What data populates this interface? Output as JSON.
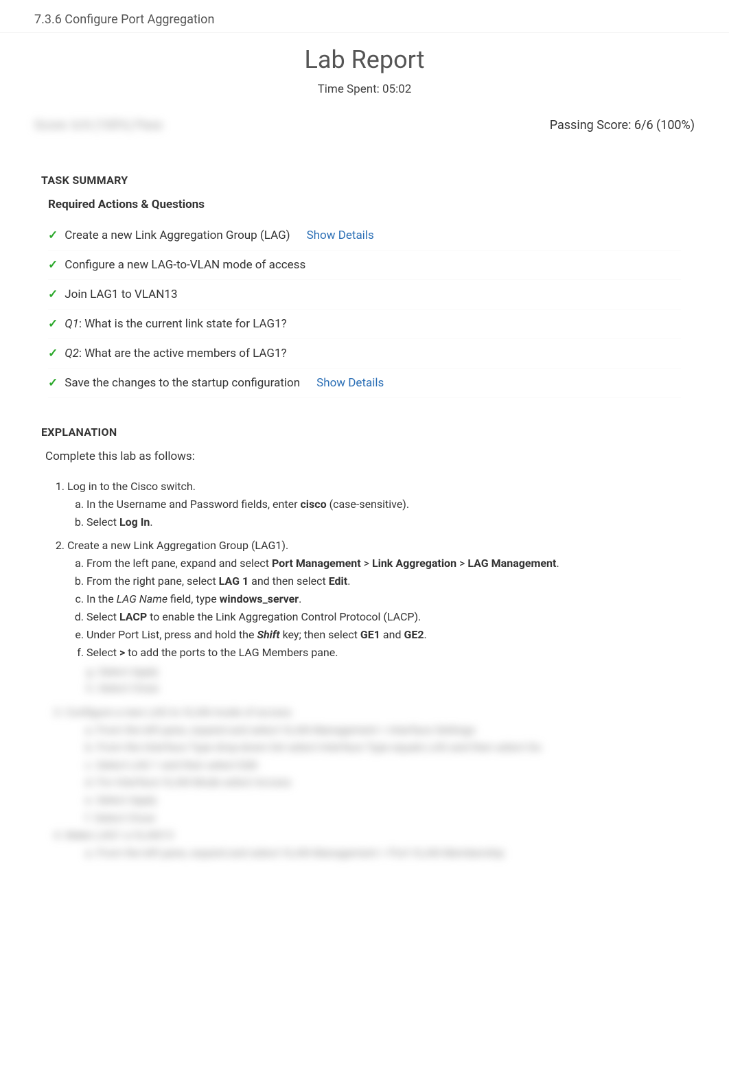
{
  "header": {
    "title": "7.3.6 Configure Port Aggregation"
  },
  "report": {
    "title": "Lab Report",
    "time_spent_label": "Time Spent: 05:02",
    "score_left_obscured": "Score: 6/6 (100%) Pass",
    "passing_score": "Passing Score: 6/6 (100%)"
  },
  "task_summary": {
    "heading": "TASK SUMMARY",
    "required_heading": "Required Actions & Questions",
    "show_details_label": "Show Details",
    "items": [
      {
        "text": "Create a new Link Aggregation Group (LAG)",
        "has_details": true
      },
      {
        "text": "Configure a new LAG-to-VLAN mode of access",
        "has_details": false
      },
      {
        "text": "Join LAG1 to VLAN13",
        "has_details": false
      },
      {
        "prefix": "Q1",
        "text": ":  What is the current link state for LAG1?",
        "has_details": false
      },
      {
        "prefix": "Q2",
        "text": ":  What are the active members of LAG1?",
        "has_details": false
      },
      {
        "text": "Save the changes to the startup configuration",
        "has_details": true
      }
    ]
  },
  "explanation": {
    "heading": "EXPLANATION",
    "intro": "Complete this lab as follows:",
    "steps": [
      {
        "title": "Log in to the Cisco switch.",
        "subs": [
          {
            "pre": "In the Username and Password fields, enter ",
            "bold": "cisco",
            "post": " (case-sensitive)."
          },
          {
            "pre": "Select ",
            "bold": "Log In",
            "post": "."
          }
        ]
      },
      {
        "title": "Create a new Link Aggregation Group (LAG1).",
        "subs": [
          {
            "raw": "From the left pane, expand and select <strong>Port Management</strong> > <strong>Link Aggregation</strong> > <strong>LAG Management</strong>."
          },
          {
            "raw": "From the right pane, select <strong>LAG 1</strong> and then select <strong>Edit</strong>."
          },
          {
            "raw": "In the <em class='italic'>LAG Name</em> field, type <strong>windows_server</strong>."
          },
          {
            "raw": "Select <strong>LACP</strong> to enable the Link Aggregation Control Protocol (LACP)."
          },
          {
            "raw": "Under Port List, press and hold the <strong><em class='italic'>Shift</em></strong> key; then select <strong>GE1</strong> and <strong>GE2</strong>."
          },
          {
            "raw": "Select <strong>&gt;</strong> to add the ports to the LAG Members pane."
          }
        ]
      }
    ],
    "blurred": {
      "line_g": "g. Select Apply",
      "line_h": "h. Select Close",
      "step3_title": "3. Configure a new LAG to VLAN mode of access",
      "step3_a": "a. From the left pane, expand and select VLAN Management > Interface Settings",
      "step3_b": "b. From the Interface Type drop-down list select Interface Type equals LAG and then select Go",
      "step3_c": "c. Select LAG 1 and then select Edit",
      "step3_d": "d. For Interface VLAN Mode select Access",
      "step3_e": "e. Select Apply",
      "step3_f": "f. Select Close",
      "step4_title": "4. Make LAG1 a VLAN13",
      "step4_a": "a. From the left pane, expand and select VLAN Management > Port VLAN Membership"
    }
  }
}
